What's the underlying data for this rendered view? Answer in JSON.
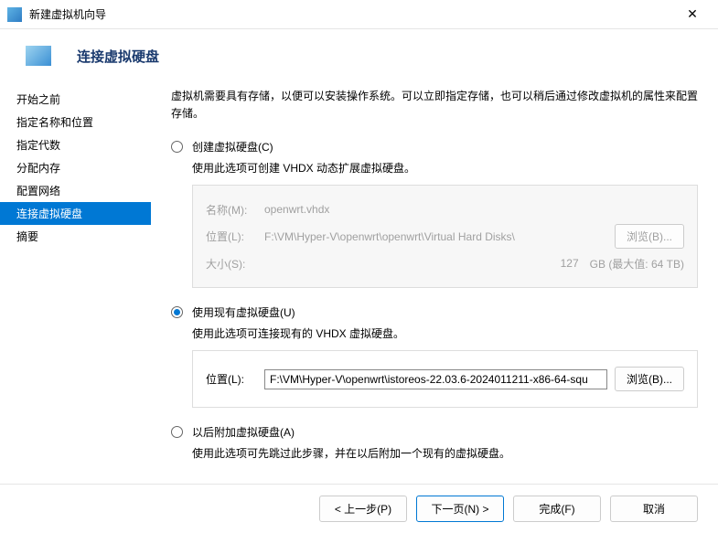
{
  "window": {
    "title": "新建虚拟机向导",
    "close": "✕"
  },
  "header": {
    "title": "连接虚拟硬盘"
  },
  "sidebar": {
    "items": [
      {
        "label": "开始之前"
      },
      {
        "label": "指定名称和位置"
      },
      {
        "label": "指定代数"
      },
      {
        "label": "分配内存"
      },
      {
        "label": "配置网络"
      },
      {
        "label": "连接虚拟硬盘"
      },
      {
        "label": "摘要"
      }
    ]
  },
  "intro": "虚拟机需要具有存储，以便可以安装操作系统。可以立即指定存储，也可以稍后通过修改虚拟机的属性来配置存储。",
  "opt_create": {
    "label": "创建虚拟硬盘(C)",
    "desc": "使用此选项可创建 VHDX 动态扩展虚拟硬盘。",
    "name_lbl": "名称(M):",
    "name_val": "openwrt.vhdx",
    "loc_lbl": "位置(L):",
    "loc_val": "F:\\VM\\Hyper-V\\openwrt\\openwrt\\Virtual Hard Disks\\",
    "browse": "浏览(B)...",
    "size_lbl": "大小(S):",
    "size_val": "127",
    "size_unit": "GB (最大值: 64 TB)"
  },
  "opt_use": {
    "label": "使用现有虚拟硬盘(U)",
    "desc": "使用此选项可连接现有的 VHDX 虚拟硬盘。",
    "loc_lbl": "位置(L):",
    "loc_val": "F:\\VM\\Hyper-V\\openwrt\\istoreos-22.03.6-2024011211-x86-64-squ",
    "browse": "浏览(B)..."
  },
  "opt_later": {
    "label": "以后附加虚拟硬盘(A)",
    "desc": "使用此选项可先跳过此步骤，并在以后附加一个现有的虚拟硬盘。"
  },
  "footer": {
    "prev": "< 上一步(P)",
    "next": "下一页(N) >",
    "finish": "完成(F)",
    "cancel": "取消"
  }
}
